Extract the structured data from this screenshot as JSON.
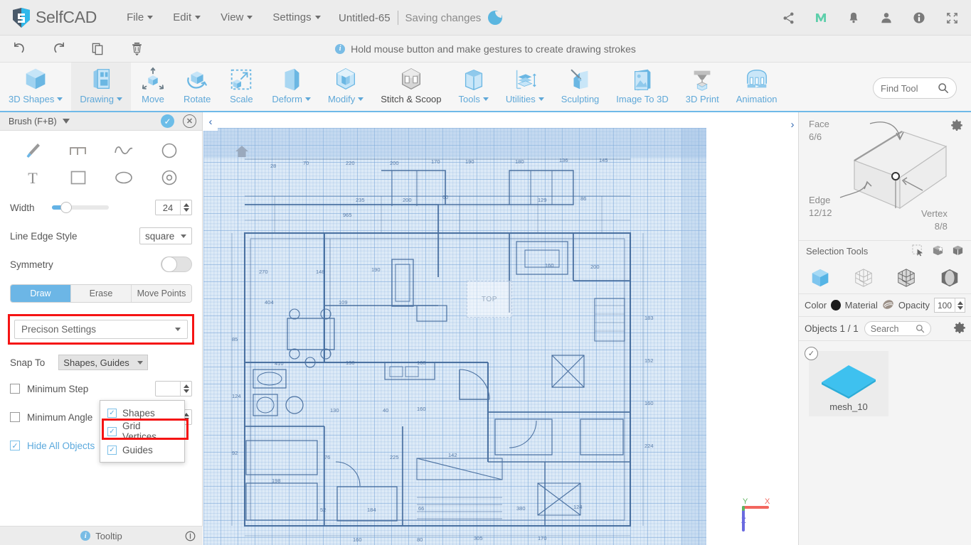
{
  "app": {
    "brand": "SelfCAD",
    "menus": [
      "File",
      "Edit",
      "View",
      "Settings"
    ],
    "doc_title": "Untitled-65",
    "save_status": "Saving changes",
    "top_right_icons": [
      "share-icon",
      "m-logo-icon",
      "bell-icon",
      "account-icon",
      "info-icon",
      "fullscreen-icon"
    ]
  },
  "actionbar": {
    "buttons": [
      "undo-icon",
      "redo-icon",
      "copy-icon",
      "delete-icon"
    ],
    "hint": "Hold mouse button and make gestures to create drawing strokes"
  },
  "ribbon": {
    "items": [
      {
        "label": "3D Shapes",
        "caret": true,
        "active": false,
        "dark": false
      },
      {
        "label": "Drawing",
        "caret": true,
        "active": true,
        "dark": false
      },
      {
        "label": "Move",
        "caret": false,
        "active": false,
        "dark": false
      },
      {
        "label": "Rotate",
        "caret": false,
        "active": false,
        "dark": false
      },
      {
        "label": "Scale",
        "caret": false,
        "active": false,
        "dark": false
      },
      {
        "label": "Deform",
        "caret": true,
        "active": false,
        "dark": false
      },
      {
        "label": "Modify",
        "caret": true,
        "active": false,
        "dark": false
      },
      {
        "label": "Stitch & Scoop",
        "caret": false,
        "active": false,
        "dark": true
      },
      {
        "label": "Tools",
        "caret": true,
        "active": false,
        "dark": false
      },
      {
        "label": "Utilities",
        "caret": true,
        "active": false,
        "dark": false
      },
      {
        "label": "Sculpting",
        "caret": false,
        "active": false,
        "dark": false
      },
      {
        "label": "Image To 3D",
        "caret": false,
        "active": false,
        "dark": false
      },
      {
        "label": "3D Print",
        "caret": false,
        "active": false,
        "dark": false
      },
      {
        "label": "Animation",
        "caret": false,
        "active": false,
        "dark": false
      }
    ],
    "find_tool_placeholder": "Find Tool"
  },
  "left_panel": {
    "title": "Brush (F+B)",
    "tools": [
      "brush-icon",
      "step-line-icon",
      "curve-icon",
      "circle-icon",
      "text-icon",
      "rectangle-icon",
      "ellipse-icon",
      "concentric-circle-icon"
    ],
    "width": {
      "label": "Width",
      "value": "24"
    },
    "line_edge_style": {
      "label": "Line Edge Style",
      "value": "square"
    },
    "symmetry": {
      "label": "Symmetry",
      "on": false
    },
    "modes": [
      {
        "label": "Draw",
        "active": true
      },
      {
        "label": "Erase",
        "active": false
      },
      {
        "label": "Move Points",
        "active": false
      }
    ],
    "precision_settings": "Precison Settings",
    "snap_to": {
      "label": "Snap To",
      "value": "Shapes, Guides"
    },
    "snap_options": [
      {
        "label": "Shapes",
        "checked": true
      },
      {
        "label": "Grid Vertices",
        "checked": true
      },
      {
        "label": "Guides",
        "checked": true
      }
    ],
    "min_step": {
      "label": "Minimum Step",
      "checked": false
    },
    "min_angle": {
      "label": "Minimum Angle",
      "checked": false
    },
    "hide_all_objects": {
      "label": "Hide All Objects",
      "checked": true
    },
    "tooltip": "Tooltip",
    "highlight_color": "#f51414"
  },
  "viewport": {
    "view_label": "TOP",
    "axis": {
      "x": "X",
      "y": "Y",
      "z": "Z",
      "x_color": "#f2665e",
      "y_color": "#5fb560",
      "z_color": "#6a6ae0"
    },
    "collapse_left": "‹",
    "expand_right": "›"
  },
  "right_panel": {
    "cube": {
      "face_label": "Face",
      "face_value": "6/6",
      "edge_label": "Edge",
      "edge_value": "12/12",
      "vertex_label": "Vertex",
      "vertex_value": "8/8"
    },
    "selection_tools_label": "Selection Tools",
    "selection_tool_icons": [
      "rect-select-icon",
      "add-select-icon",
      "subtract-select-icon"
    ],
    "selection_modes": [
      "object-mode-icon",
      "vertex-mode-icon",
      "edge-mode-icon",
      "face-mode-icon"
    ],
    "color_label": "Color",
    "color_value": "#1b1b1b",
    "material_label": "Material",
    "opacity_label": "Opacity",
    "opacity_value": "100",
    "objects_label": "Objects 1 / 1",
    "search_placeholder": "Search",
    "objects": [
      {
        "name": "mesh_10",
        "selected": true,
        "color": "#3ec1ef"
      }
    ]
  }
}
